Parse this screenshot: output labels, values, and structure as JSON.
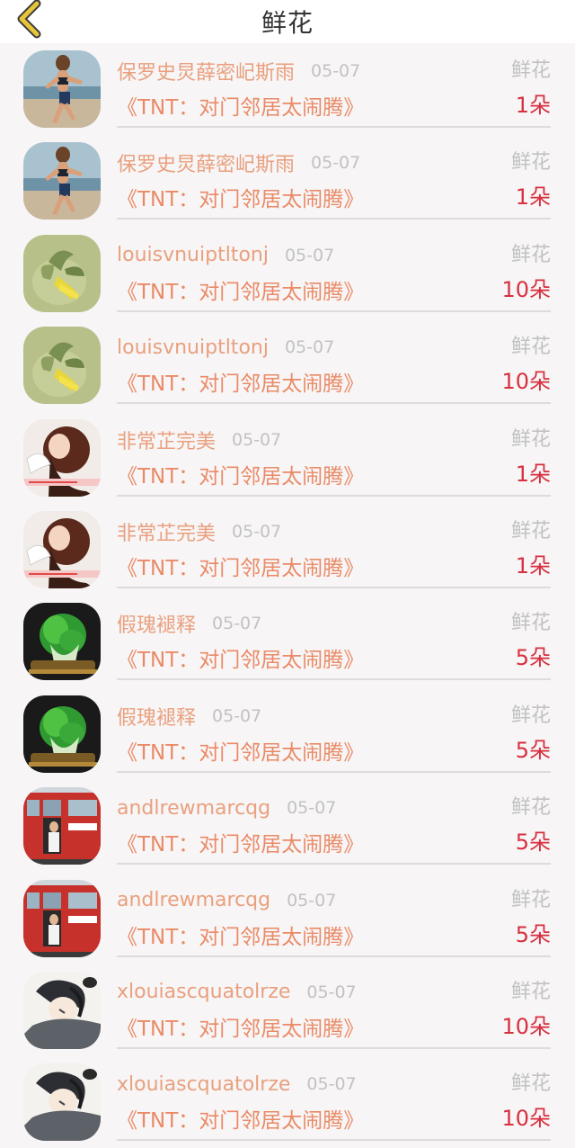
{
  "header": {
    "title": "鲜花",
    "back_icon": "chevron-left-icon",
    "accent_color": "#e6c53a"
  },
  "colors": {
    "username": "#e9a07e",
    "work": "#ea8a66",
    "quantity": "#d7303f",
    "muted": "#c2c2c2"
  },
  "records": [
    {
      "avatar": "runner-photo",
      "username": "保罗史炅薛密屺斯雨",
      "date": "05-07",
      "gift": "鲜花",
      "work": "《TNT：对门邻居太闹腾》",
      "qty": "1朵"
    },
    {
      "avatar": "runner-photo",
      "username": "保罗史炅薛密屺斯雨",
      "date": "05-07",
      "gift": "鲜花",
      "work": "《TNT：对门邻居太闹腾》",
      "qty": "1朵"
    },
    {
      "avatar": "leaf-photo",
      "username": "louisvnuiptltonj",
      "date": "05-07",
      "gift": "鲜花",
      "work": "《TNT：对门邻居太闹腾》",
      "qty": "10朵"
    },
    {
      "avatar": "leaf-photo",
      "username": "louisvnuiptltonj",
      "date": "05-07",
      "gift": "鲜花",
      "work": "《TNT：对门邻居太闹腾》",
      "qty": "10朵"
    },
    {
      "avatar": "girl-illustration",
      "username": "非常芷完美",
      "date": "05-07",
      "gift": "鲜花",
      "work": "《TNT：对门邻居太闹腾》",
      "qty": "1朵"
    },
    {
      "avatar": "girl-illustration",
      "username": "非常芷完美",
      "date": "05-07",
      "gift": "鲜花",
      "work": "《TNT：对门邻居太闹腾》",
      "qty": "1朵"
    },
    {
      "avatar": "jade-cabbage-photo",
      "username": "假瑰褪释",
      "date": "05-07",
      "gift": "鲜花",
      "work": "《TNT：对门邻居太闹腾》",
      "qty": "5朵"
    },
    {
      "avatar": "jade-cabbage-photo",
      "username": "假瑰褪释",
      "date": "05-07",
      "gift": "鲜花",
      "work": "《TNT：对门邻居太闹腾》",
      "qty": "5朵"
    },
    {
      "avatar": "red-bus-photo",
      "username": "andlrewmarcqg",
      "date": "05-07",
      "gift": "鲜花",
      "work": "《TNT：对门邻居太闹腾》",
      "qty": "5朵"
    },
    {
      "avatar": "red-bus-photo",
      "username": "andlrewmarcqg",
      "date": "05-07",
      "gift": "鲜花",
      "work": "《TNT：对门邻居太闹腾》",
      "qty": "5朵"
    },
    {
      "avatar": "anime-boy-illustration",
      "username": "xlouiascquatolrze",
      "date": "05-07",
      "gift": "鲜花",
      "work": "《TNT：对门邻居太闹腾》",
      "qty": "10朵"
    },
    {
      "avatar": "anime-boy-illustration",
      "username": "xlouiascquatolrze",
      "date": "05-07",
      "gift": "鲜花",
      "work": "《TNT：对门邻居太闹腾》",
      "qty": "10朵"
    }
  ]
}
